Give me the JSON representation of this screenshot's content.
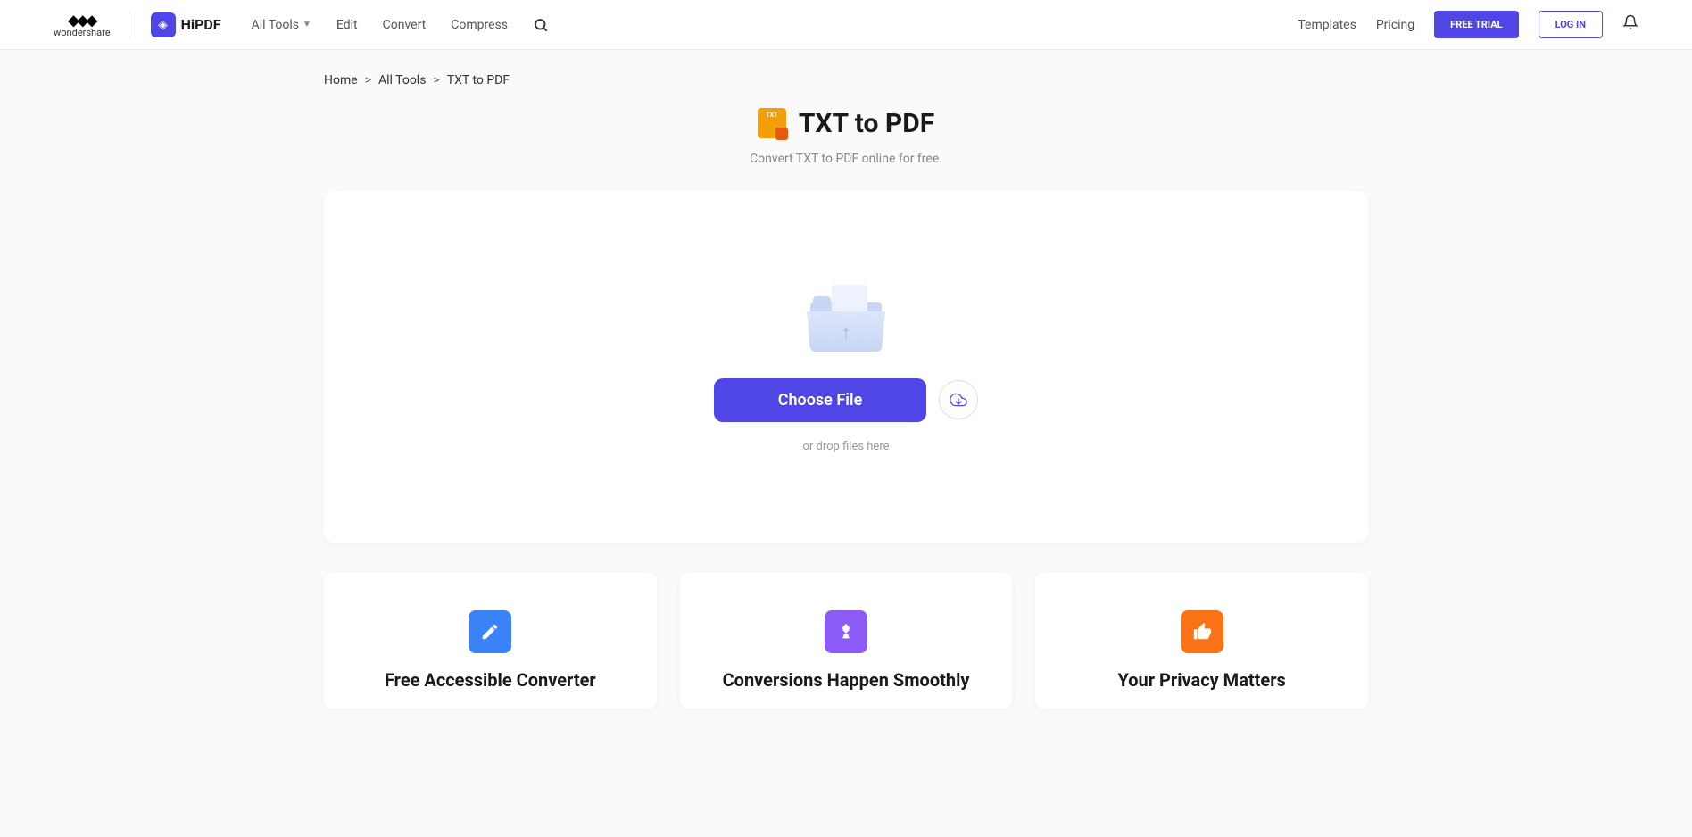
{
  "header": {
    "wondershare_label": "wondershare",
    "hipdf_label": "HiPDF",
    "nav": {
      "all_tools": "All Tools",
      "edit": "Edit",
      "convert": "Convert",
      "compress": "Compress"
    },
    "templates": "Templates",
    "pricing": "Pricing",
    "free_trial": "FREE TRIAL",
    "login": "LOG IN"
  },
  "breadcrumb": {
    "home": "Home",
    "all_tools": "All Tools",
    "current": "TXT to PDF"
  },
  "page": {
    "title": "TXT to PDF",
    "subtitle": "Convert TXT to PDF online for free."
  },
  "upload": {
    "choose_file": "Choose File",
    "drop_text": "or drop files here"
  },
  "features": [
    {
      "title": "Free Accessible Converter",
      "color": "blue",
      "icon": "edit"
    },
    {
      "title": "Conversions Happen Smoothly",
      "color": "purple",
      "icon": "badge"
    },
    {
      "title": "Your Privacy Matters",
      "color": "orange",
      "icon": "thumbs-up"
    }
  ]
}
